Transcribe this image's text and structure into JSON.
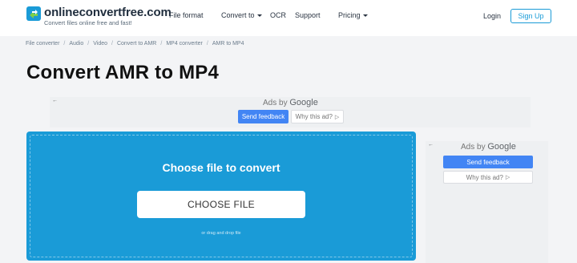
{
  "brand": {
    "name": "onlineconvertfree.com",
    "tagline": "Convert files online free and fast!",
    "accent": "#1a9bd7"
  },
  "nav": {
    "items": [
      {
        "label": "File format",
        "has_caret": false
      },
      {
        "label": "Convert to",
        "has_caret": true
      },
      {
        "label": "OCR",
        "has_caret": false
      },
      {
        "label": "Support",
        "has_caret": false
      },
      {
        "label": "Pricing",
        "has_caret": true
      }
    ],
    "login": "Login",
    "signup": "Sign Up"
  },
  "breadcrumb": [
    "File converter",
    "Audio",
    "Video",
    "Convert to AMR",
    "MP4 converter",
    "AMR to MP4"
  ],
  "page_title": "Convert AMR to MP4",
  "ad_top": {
    "back_icon": "arrow-left-icon",
    "label_prefix": "Ads by",
    "label_brand": "Google",
    "send_feedback": "Send feedback",
    "why_this_ad": "Why this ad?",
    "feedback_color": "#4285f4"
  },
  "upload": {
    "title": "Choose file to convert",
    "button": "CHOOSE FILE",
    "drag_text": "or drag and drop file"
  },
  "ad_side": {
    "back_icon": "arrow-left-icon",
    "label_prefix": "Ads by",
    "label_brand": "Google",
    "send_feedback": "Send feedback",
    "why_this_ad": "Why this ad?"
  }
}
